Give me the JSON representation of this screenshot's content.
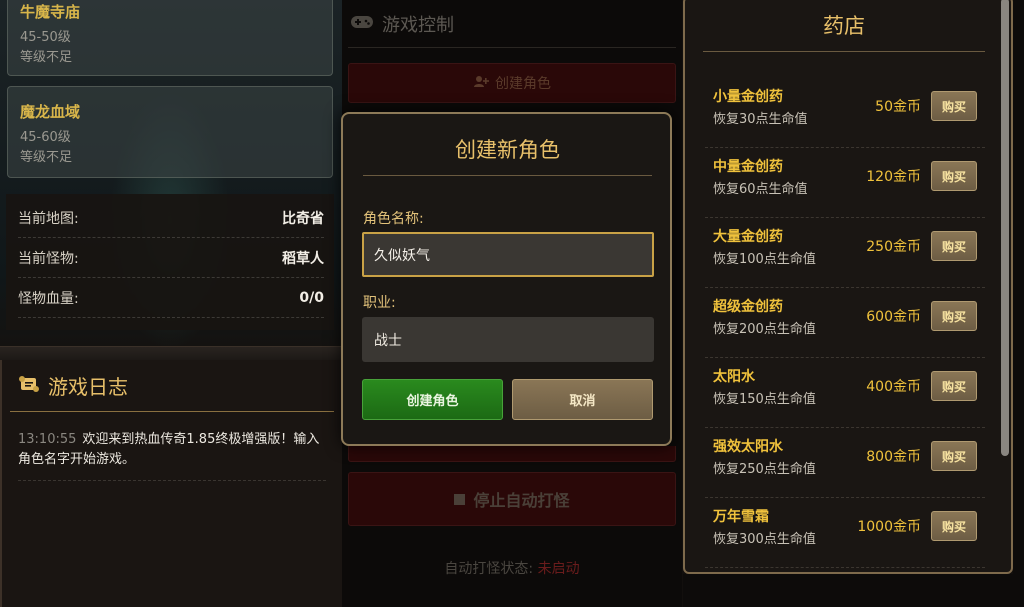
{
  "maps": [
    {
      "name": "牛魔寺庙",
      "level": "45-50级",
      "status": "等级不足"
    },
    {
      "name": "魔龙血域",
      "level": "45-60级",
      "status": "等级不足"
    }
  ],
  "info": {
    "map_label": "当前地图:",
    "map_value": "比奇省",
    "monster_label": "当前怪物:",
    "monster_value": "稻草人",
    "hp_label": "怪物血量:",
    "hp_value": "0/0"
  },
  "log": {
    "title": "游戏日志",
    "entries": [
      {
        "time": "13:10:55",
        "text": "欢迎来到热血传奇1.85终极增强版！输入角色名字开始游戏。"
      }
    ]
  },
  "control": {
    "title": "游戏控制",
    "create_role_label": "创建角色",
    "stop_auto_label": "停止自动打怪",
    "status_label": "自动打怪状态:",
    "status_value": "未启动"
  },
  "modal": {
    "title": "创建新角色",
    "name_label": "角色名称:",
    "name_value": "久似妖气",
    "class_label": "职业:",
    "class_value": "战士",
    "create_label": "创建角色",
    "cancel_label": "取消"
  },
  "shop": {
    "title": "药店",
    "buy_label": "购买",
    "items": [
      {
        "name": "小量金创药",
        "desc": "恢复30点生命值",
        "price": "50金币"
      },
      {
        "name": "中量金创药",
        "desc": "恢复60点生命值",
        "price": "120金币"
      },
      {
        "name": "大量金创药",
        "desc": "恢复100点生命值",
        "price": "250金币"
      },
      {
        "name": "超级金创药",
        "desc": "恢复200点生命值",
        "price": "600金币"
      },
      {
        "name": "太阳水",
        "desc": "恢复150点生命值",
        "price": "400金币"
      },
      {
        "name": "强效太阳水",
        "desc": "恢复250点生命值",
        "price": "800金币"
      },
      {
        "name": "万年雪霜",
        "desc": "恢复300点生命值",
        "price": "1000金币"
      }
    ]
  },
  "colors": {
    "gold": "#e8c06a",
    "item_gold": "#f0c23c",
    "create_green": "#1c6a14",
    "status_off": "#6a1c1c"
  }
}
